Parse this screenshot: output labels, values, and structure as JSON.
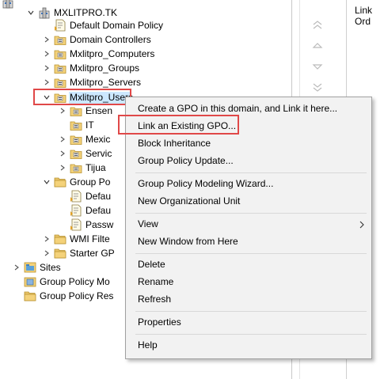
{
  "tree": {
    "root": "MXLITPRO.TK",
    "items": [
      {
        "label": "Default Domain Policy"
      },
      {
        "label": "Domain Controllers"
      },
      {
        "label": "Mxlitpro_Computers"
      },
      {
        "label": "Mxlitpro_Groups"
      },
      {
        "label": "Mxlitpro_Servers"
      },
      {
        "label": "Mxlitpro_Users"
      },
      {
        "label": "Ensen"
      },
      {
        "label": "IT"
      },
      {
        "label": "Mexic"
      },
      {
        "label": "Servic"
      },
      {
        "label": "Tijua"
      },
      {
        "label": "Group Po"
      },
      {
        "label": "Defau"
      },
      {
        "label": "Defau"
      },
      {
        "label": "Passw"
      },
      {
        "label": "WMI Filte"
      },
      {
        "label": "Starter GP"
      },
      {
        "label": "Sites"
      },
      {
        "label": "Group Policy Mo"
      },
      {
        "label": "Group Policy Res"
      }
    ]
  },
  "right_pane": {
    "column_header": "Link Ord"
  },
  "context_menu": {
    "items": [
      {
        "label": "Create a GPO in this domain, and Link it here..."
      },
      {
        "label": "Link an Existing GPO..."
      },
      {
        "label": "Block Inheritance"
      },
      {
        "label": "Group Policy Update..."
      },
      {
        "label": "Group Policy Modeling Wizard..."
      },
      {
        "label": "New Organizational Unit"
      },
      {
        "label": "View"
      },
      {
        "label": "New Window from Here"
      },
      {
        "label": "Delete"
      },
      {
        "label": "Rename"
      },
      {
        "label": "Refresh"
      },
      {
        "label": "Properties"
      },
      {
        "label": "Help"
      }
    ]
  },
  "colors": {
    "highlight_border": "#e04848",
    "selection": "#cce8ff",
    "menu_bg": "#f2f2f2"
  }
}
